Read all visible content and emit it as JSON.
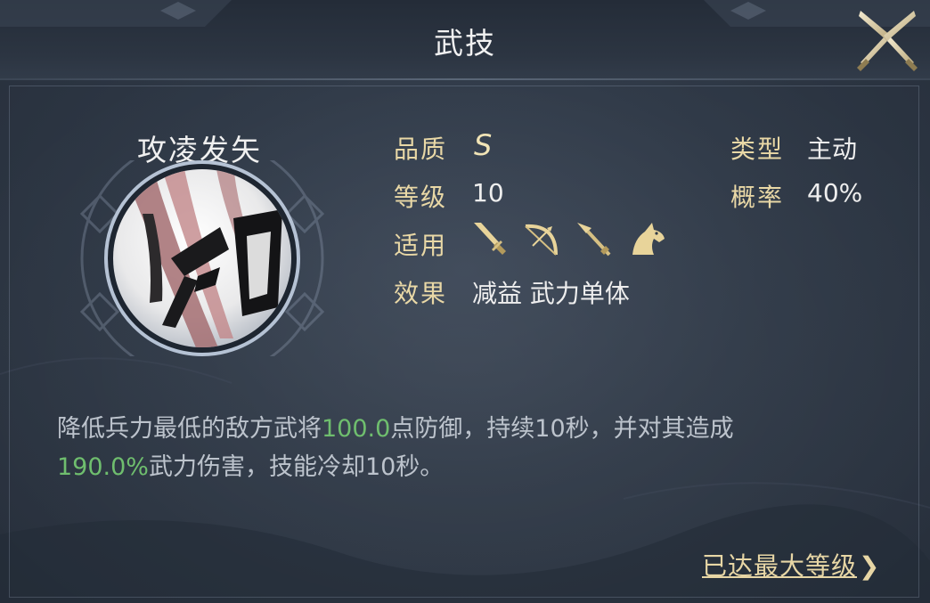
{
  "header": {
    "title": "武技"
  },
  "skill": {
    "name": "攻凌发矢",
    "quality_label": "品质",
    "quality_value": "S",
    "level_label": "等级",
    "level_value": "10",
    "applicable_label": "适用",
    "applicable_icons": [
      "sword-icon",
      "bow-icon",
      "spear-icon",
      "horse-icon"
    ],
    "effect_label": "效果",
    "effect_value": "减益 武力单体",
    "type_label": "类型",
    "type_value": "主动",
    "chance_label": "概率",
    "chance_value": "40%"
  },
  "description": {
    "part1": "降低兵力最低的敌方武将",
    "hl1": "100.0",
    "part2": "点防御，持续10秒，并对其造成",
    "hl2": "190.0%",
    "part3": "武力伤害，技能冷却10秒。"
  },
  "footer": {
    "max_level_link": "已达最大等级",
    "chevron": "❯"
  },
  "colors": {
    "label_gold": "#e9d8a6",
    "highlight_green": "#6fbe6e",
    "background": "#2f3947"
  }
}
